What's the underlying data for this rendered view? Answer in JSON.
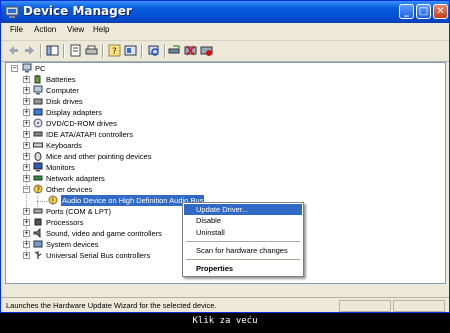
{
  "window": {
    "title": "Device Manager",
    "min_label": "_",
    "max_label": "□",
    "close_label": "✕"
  },
  "menu": [
    "File",
    "Action",
    "View",
    "Help"
  ],
  "tree": {
    "root": "PC",
    "categories": [
      {
        "label": "Batteries",
        "icon": "battery-icon"
      },
      {
        "label": "Computer",
        "icon": "computer-icon"
      },
      {
        "label": "Disk drives",
        "icon": "disk-drive-icon"
      },
      {
        "label": "Display adapters",
        "icon": "display-adapter-icon"
      },
      {
        "label": "DVD/CD-ROM drives",
        "icon": "cdrom-icon"
      },
      {
        "label": "IDE ATA/ATAPI controllers",
        "icon": "ide-controller-icon"
      },
      {
        "label": "Keyboards",
        "icon": "keyboard-icon"
      },
      {
        "label": "Mice and other pointing devices",
        "icon": "mouse-icon"
      },
      {
        "label": "Monitors",
        "icon": "monitor-icon"
      },
      {
        "label": "Network adapters",
        "icon": "network-adapter-icon"
      },
      {
        "label": "Other devices",
        "icon": "unknown-device-icon"
      },
      {
        "label": "Audio Device on High Definition Audio Bus",
        "icon": "warning-device-icon"
      },
      {
        "label": "Ports (COM & LPT)",
        "icon": "port-icon"
      },
      {
        "label": "Processors",
        "icon": "processor-icon"
      },
      {
        "label": "Sound, video and game controllers",
        "icon": "sound-icon"
      },
      {
        "label": "System devices",
        "icon": "system-device-icon"
      },
      {
        "label": "Universal Serial Bus controllers",
        "icon": "usb-icon"
      }
    ]
  },
  "context_menu": {
    "items": [
      "Update Driver...",
      "Disable",
      "Uninstall",
      "Scan for hardware changes",
      "Properties"
    ]
  },
  "status": "Launches the Hardware Update Wizard for the selected device.",
  "caption": "Klik za veću",
  "colors": {
    "titlebar": "#0a5fdc",
    "selection": "#316ac5",
    "window_bg": "#ece9d8"
  }
}
